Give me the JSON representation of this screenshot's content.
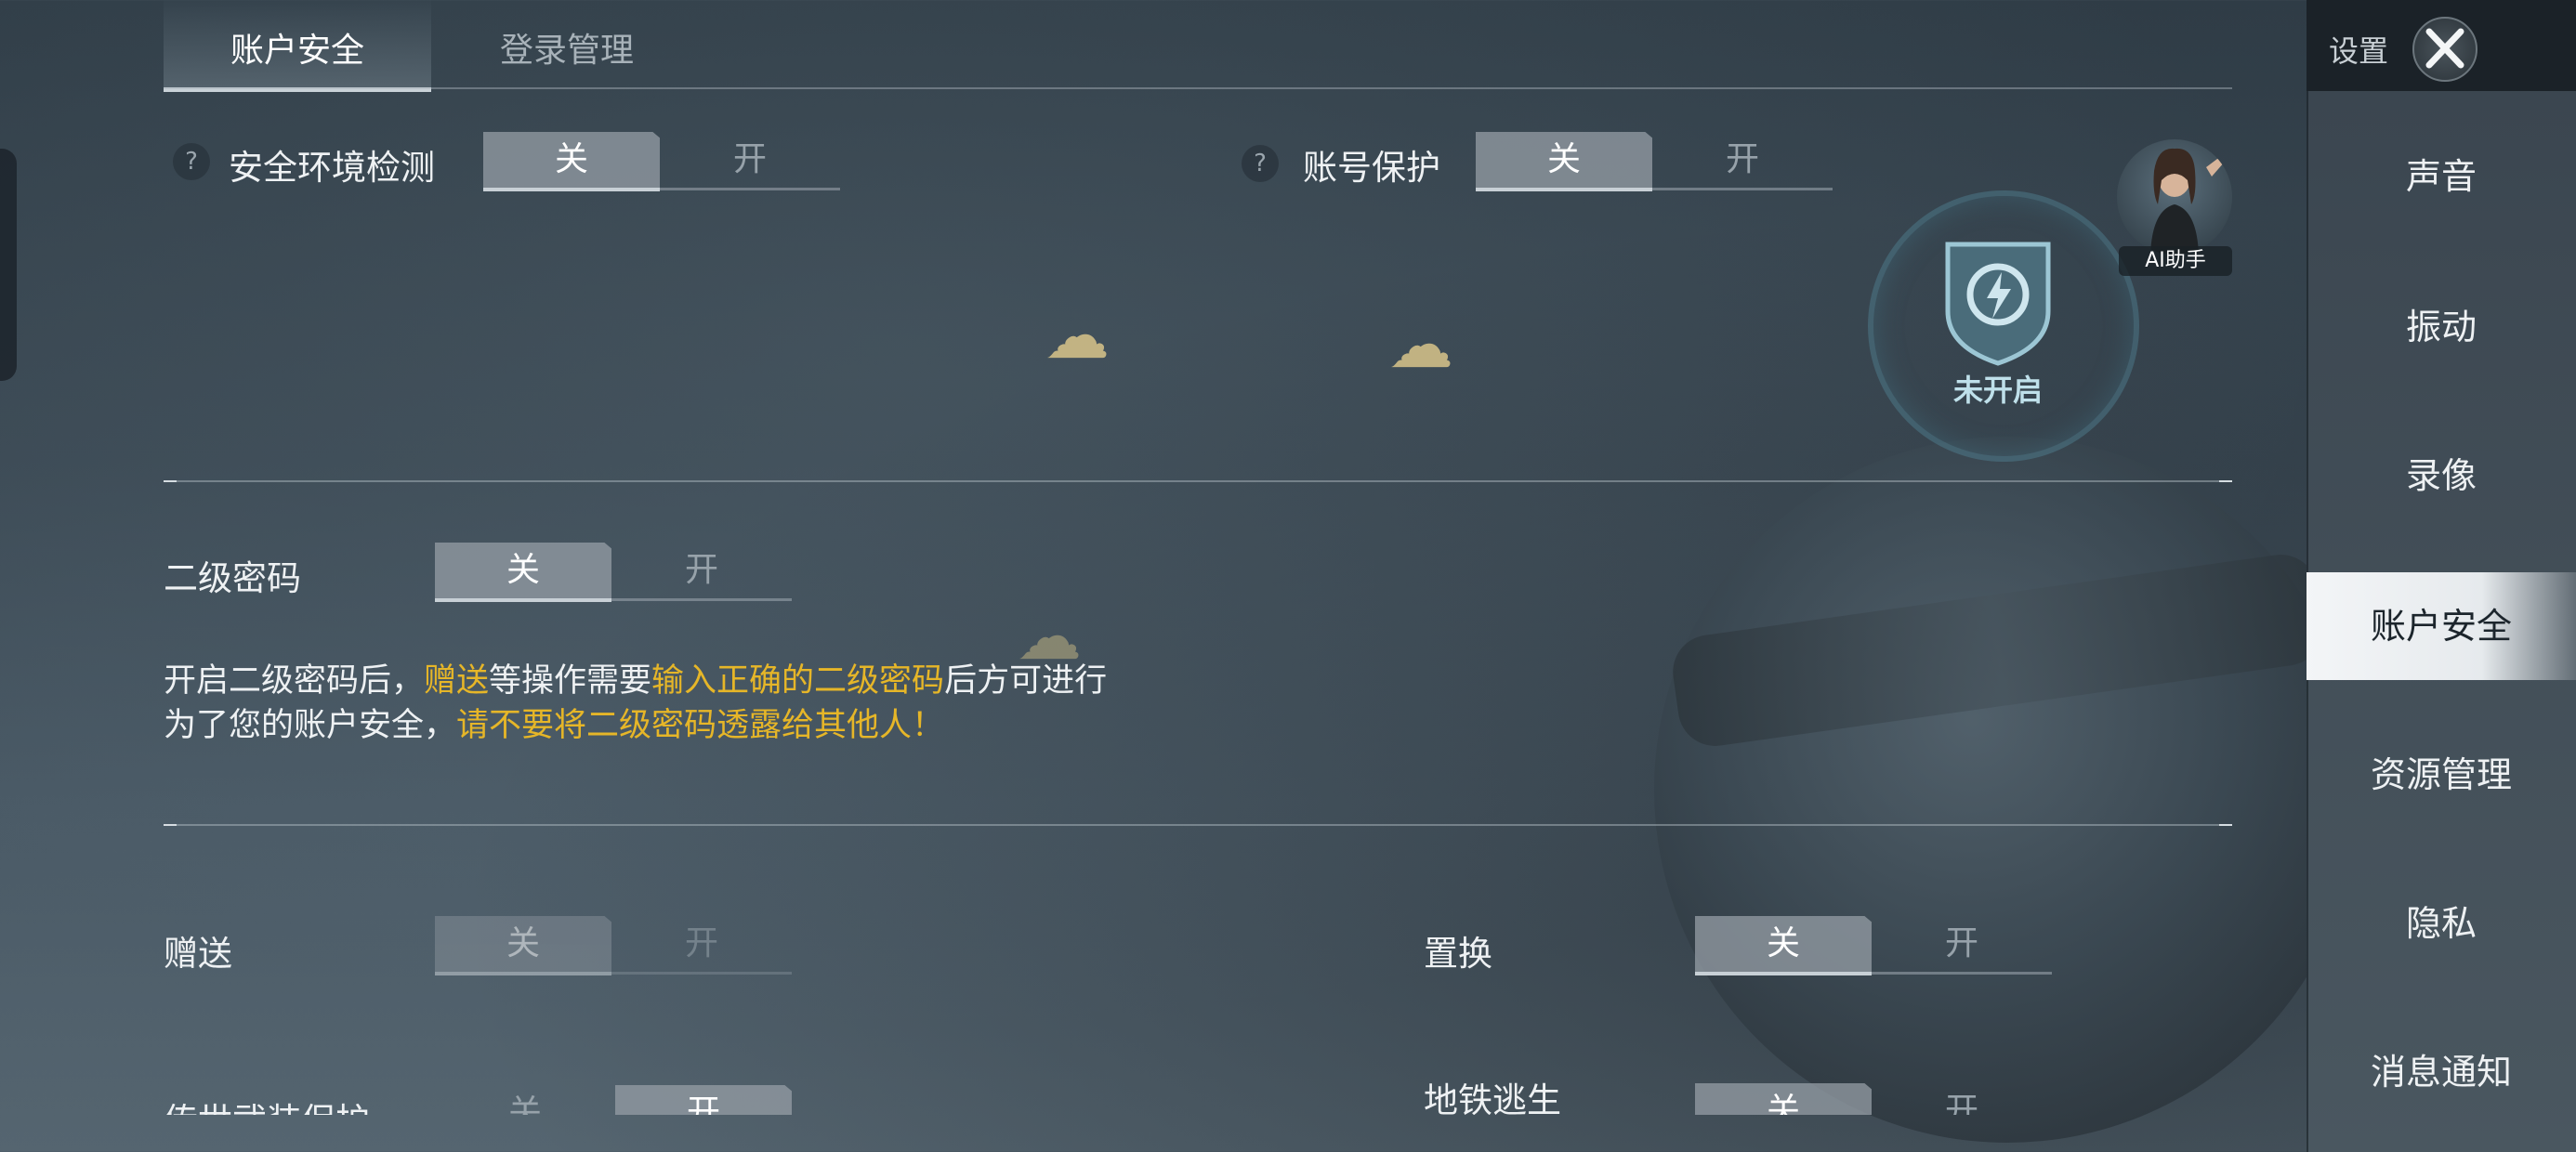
{
  "tabs": [
    {
      "label": "账户安全"
    },
    {
      "label": "登录管理"
    }
  ],
  "help_icon": "?",
  "toggle_off": "关",
  "toggle_on": "开",
  "security_env": {
    "label": "安全环境检测"
  },
  "account_protect": {
    "label": "账号保护"
  },
  "shield_status": "未开启",
  "ai_assistant": "AI助手",
  "second_password": {
    "label": "二级密码",
    "desc_line1": [
      "开启二级密码后，",
      "赠送",
      "等操作需要",
      "输入正确的二级密码",
      "后方可进行"
    ],
    "desc_line2": [
      "为了您的账户安全，",
      "请不要将二级密码透露给其他人！"
    ]
  },
  "gift": {
    "label": "赠送"
  },
  "replace": {
    "label": "置换"
  },
  "legendary": {
    "label": "传世武装保护"
  },
  "metro": {
    "label": "地铁逃生"
  },
  "sidebar": {
    "title": "设置",
    "items": [
      {
        "label": "声音"
      },
      {
        "label": "振动"
      },
      {
        "label": "录像"
      },
      {
        "label": "账户安全"
      },
      {
        "label": "资源管理"
      },
      {
        "label": "隐私"
      },
      {
        "label": "消息通知"
      }
    ]
  },
  "colors": {
    "highlight": "#e6b628",
    "sidebar_active": "#eef1f3"
  }
}
